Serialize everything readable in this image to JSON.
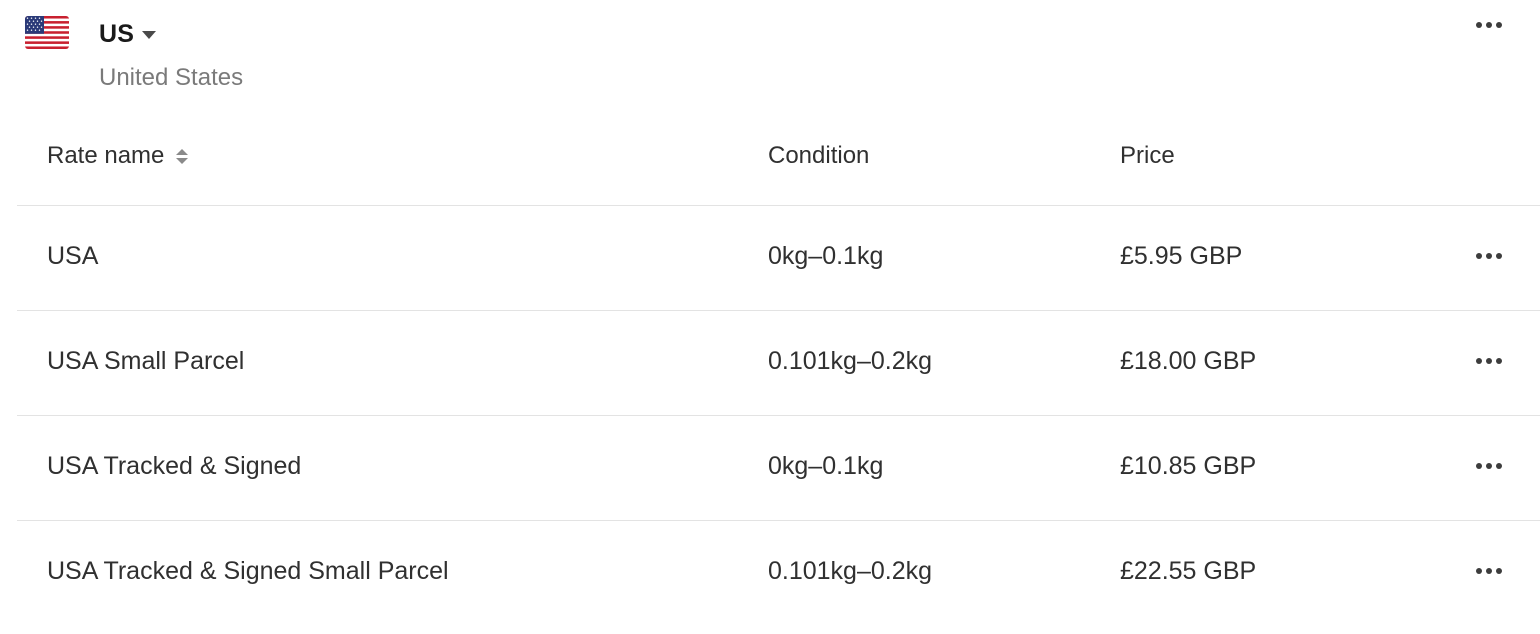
{
  "zone": {
    "code": "US",
    "country_name": "United States",
    "flag_icon": "us-flag-icon",
    "more_icon": "more-horizontal-icon"
  },
  "table": {
    "columns": {
      "name": "Rate name",
      "condition": "Condition",
      "price": "Price"
    },
    "rows": [
      {
        "name": "USA",
        "condition": "0kg–0.1kg",
        "price": "£5.95 GBP"
      },
      {
        "name": "USA Small Parcel",
        "condition": "0.101kg–0.2kg",
        "price": "£18.00 GBP"
      },
      {
        "name": "USA Tracked & Signed",
        "condition": "0kg–0.1kg",
        "price": "£10.85 GBP"
      },
      {
        "name": "USA Tracked & Signed Small Parcel",
        "condition": "0.101kg–0.2kg",
        "price": "£22.55 GBP"
      }
    ]
  },
  "colors": {
    "text": "#303030",
    "muted": "#7a7a7a",
    "divider": "#e3e3e3"
  }
}
